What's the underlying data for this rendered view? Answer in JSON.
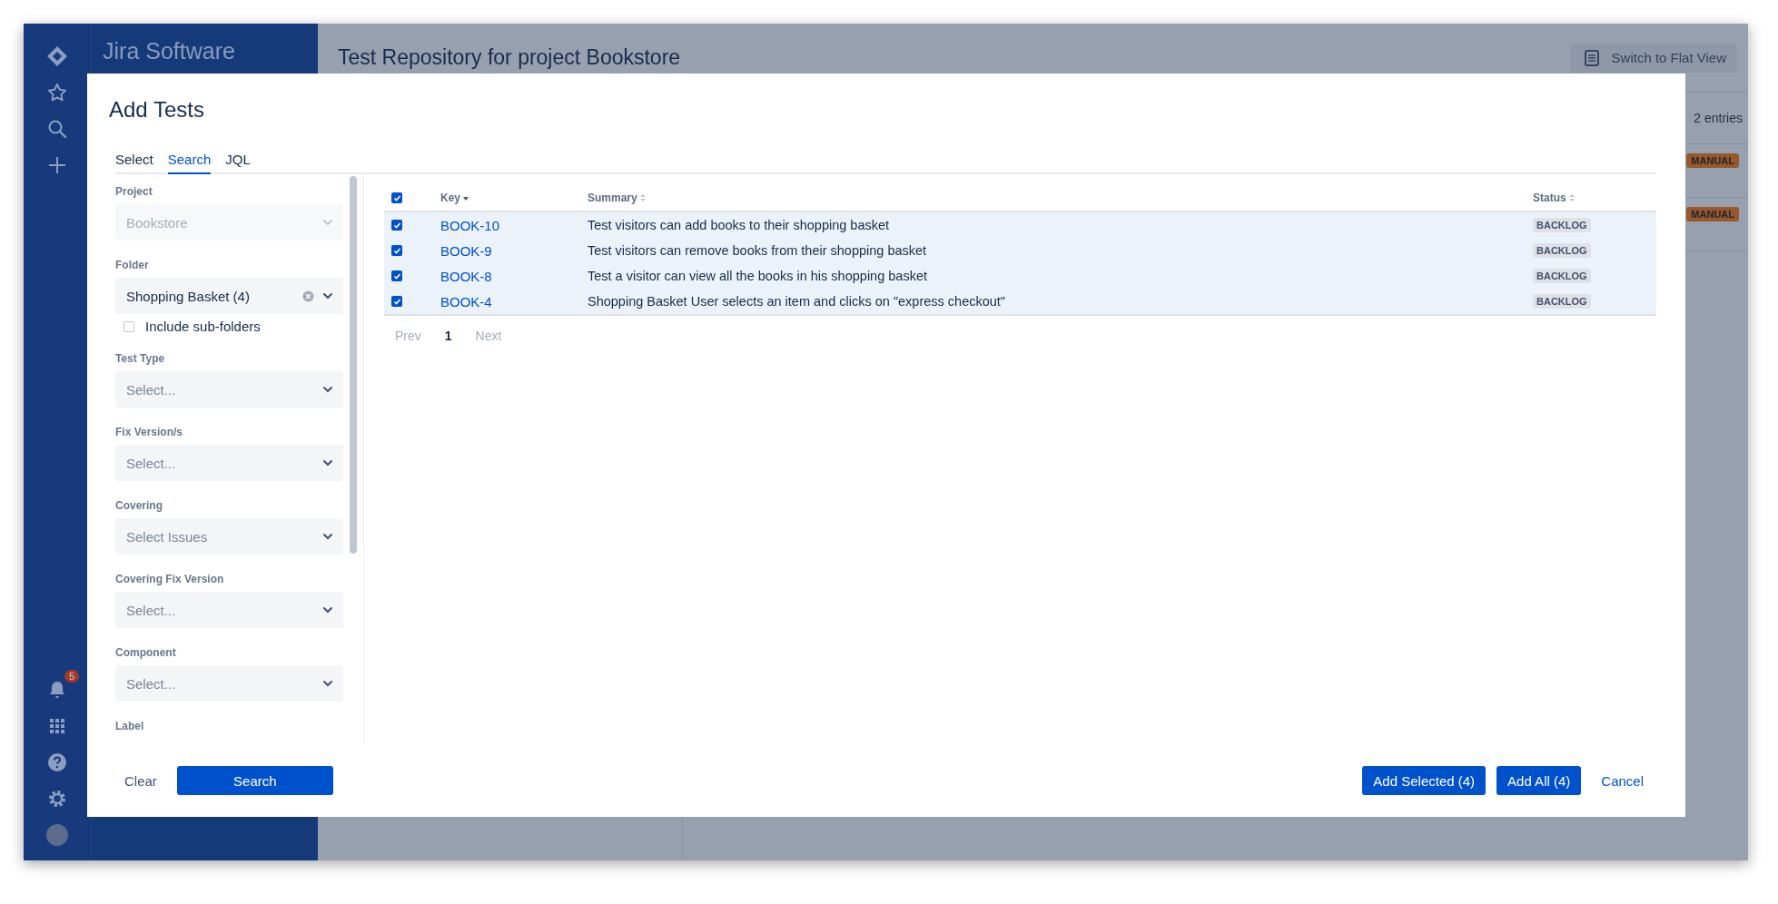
{
  "app": {
    "product": "Jira Software",
    "notification_count": "5"
  },
  "page": {
    "title": "Test Repository for project Bookstore",
    "flat_view_button": "Switch to Flat View",
    "entries": "2 entries",
    "rows": [
      {
        "type": "MANUAL"
      },
      {
        "type": "MANUAL"
      }
    ]
  },
  "modal": {
    "title": "Add Tests",
    "tabs": [
      {
        "label": "Select",
        "selected": false
      },
      {
        "label": "Search",
        "selected": true
      },
      {
        "label": "JQL",
        "selected": false
      }
    ],
    "filters": [
      {
        "label": "Project",
        "value": "Bookstore",
        "disabled": true
      },
      {
        "label": "Folder",
        "value": "Shopping Basket (4)",
        "disabled": false,
        "clearable": true,
        "option": {
          "label": "Include sub-folders",
          "checked": false
        }
      },
      {
        "label": "Test Type",
        "placeholder": "Select...",
        "disabled": false
      },
      {
        "label": "Fix Version/s",
        "placeholder": "Select...",
        "disabled": false
      },
      {
        "label": "Covering",
        "placeholder": "Select Issues",
        "disabled": false
      },
      {
        "label": "Covering Fix Version",
        "placeholder": "Select...",
        "disabled": false
      },
      {
        "label": "Component",
        "placeholder": "Select...",
        "disabled": false
      },
      {
        "label": "Label"
      }
    ],
    "table": {
      "all_checked": true,
      "columns": [
        {
          "label": "Key",
          "sorted": true
        },
        {
          "label": "Summary",
          "sorted": false
        },
        {
          "label": "Status",
          "sorted": false
        }
      ],
      "rows": [
        {
          "key": "BOOK-10",
          "summary": "Test visitors can add books to their shopping basket",
          "status": "BACKLOG",
          "checked": true
        },
        {
          "key": "BOOK-9",
          "summary": "Test visitors can remove books from their shopping basket",
          "status": "BACKLOG",
          "checked": true
        },
        {
          "key": "BOOK-8",
          "summary": "Test a visitor can view all the books in his shopping basket",
          "status": "BACKLOG",
          "checked": true
        },
        {
          "key": "BOOK-4",
          "summary": "Shopping Basket User selects an item and clicks on \"express checkout\"",
          "status": "BACKLOG",
          "checked": true
        }
      ]
    },
    "pagination": {
      "prev": "Prev",
      "pages": [
        {
          "label": "1",
          "selected": true
        }
      ],
      "next": "Next"
    },
    "footer": {
      "clear": "Clear",
      "search": "Search",
      "add_selected": "Add Selected (4)",
      "add_all": "Add All (4)",
      "cancel": "Cancel"
    }
  }
}
